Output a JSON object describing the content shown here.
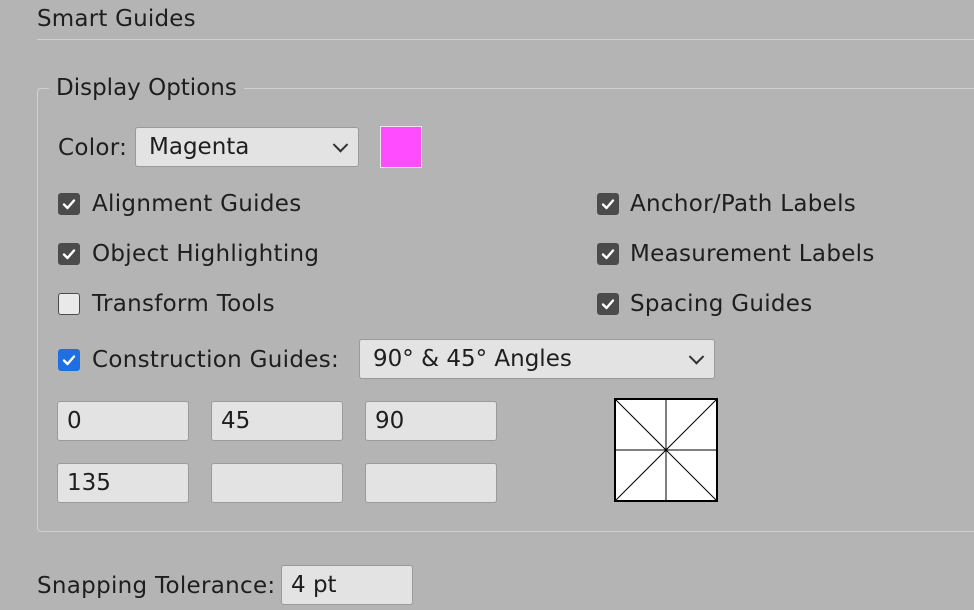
{
  "section": {
    "title": "Smart Guides"
  },
  "display_options": {
    "legend": "Display Options",
    "color_label": "Color:",
    "color_value": "Magenta",
    "color_swatch": "#ff4cff",
    "checkboxes": [
      {
        "label": "Alignment Guides",
        "checked": true
      },
      {
        "label": "Anchor/Path Labels",
        "checked": true
      },
      {
        "label": "Object Highlighting",
        "checked": true
      },
      {
        "label": "Measurement Labels",
        "checked": true
      },
      {
        "label": "Transform Tools",
        "checked": false
      },
      {
        "label": "Spacing Guides",
        "checked": true
      }
    ],
    "construction": {
      "label": "Construction Guides:",
      "checked": true,
      "angles_value": "90° & 45° Angles",
      "angle_fields": [
        "0",
        "45",
        "90",
        "135",
        "",
        ""
      ]
    }
  },
  "snapping": {
    "label": "Snapping Tolerance:",
    "value": "4 pt"
  },
  "colors": {
    "background": "#b4b4b4",
    "checkbox_checked": "#4b4b4b",
    "checkbox_accent": "#1f6fe0"
  }
}
